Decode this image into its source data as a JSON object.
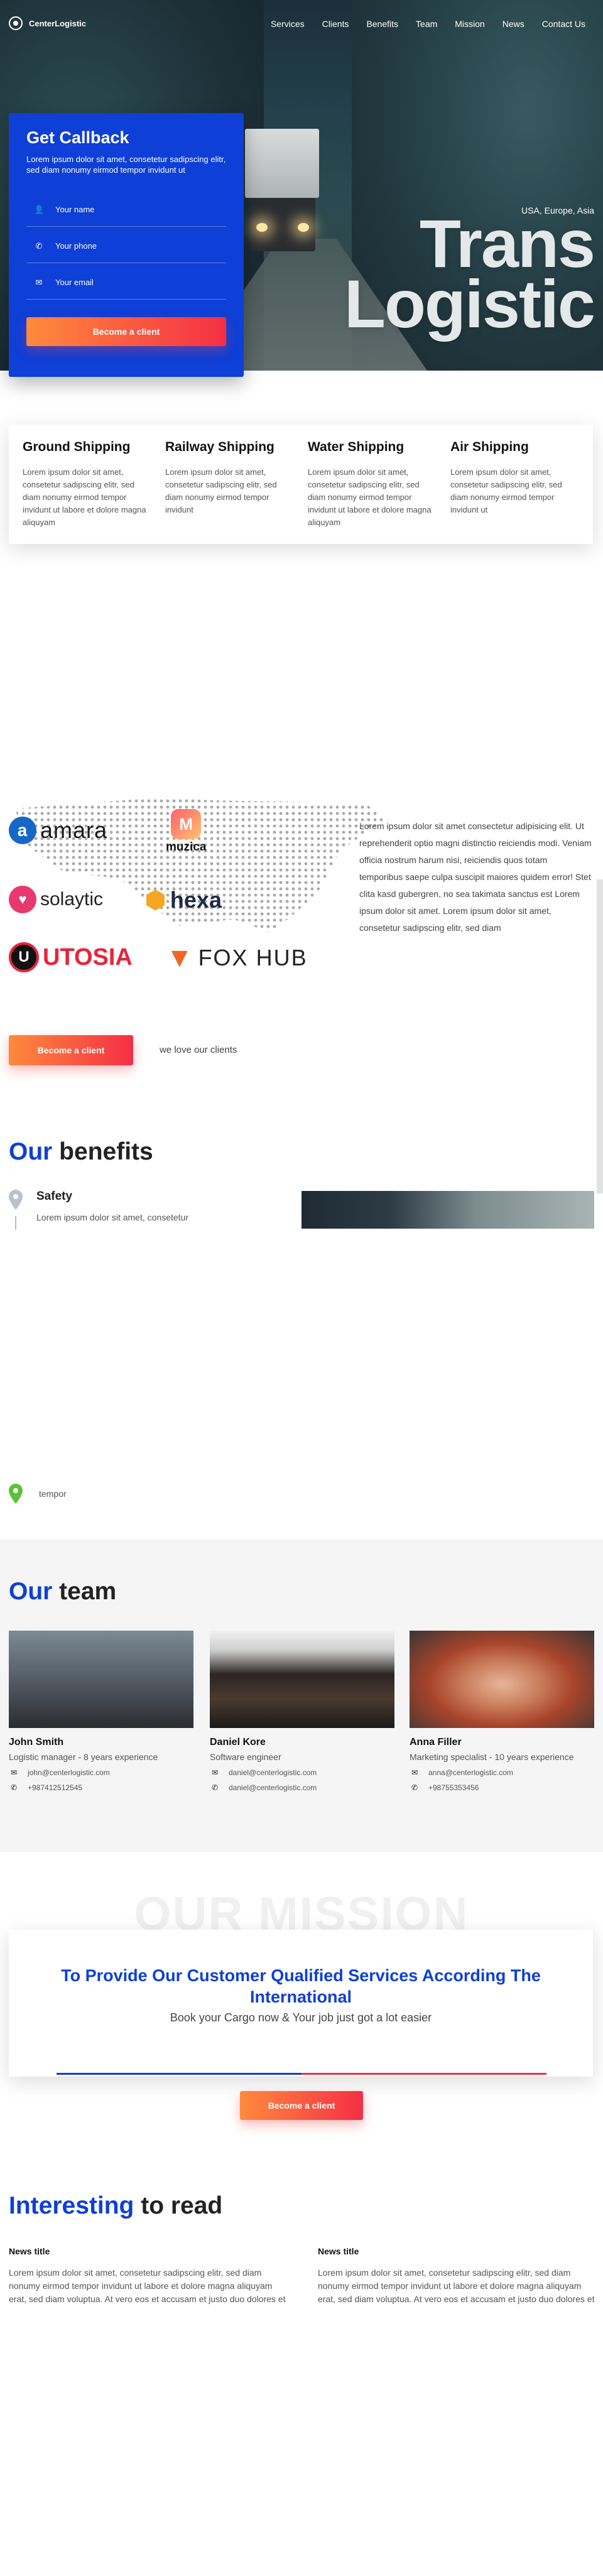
{
  "nav": {
    "logo_text": "CenterLogistic",
    "items": [
      "Services",
      "Clients",
      "Benefits",
      "Team",
      "Mission",
      "News",
      "Contact Us"
    ]
  },
  "callback": {
    "title": "Get Callback",
    "text": "Lorem ipsum dolor sit amet, consetetur sadipscing elitr, sed diam nonumy eirmod tempor invidunt ut",
    "fields": [
      {
        "icon": "user-icon",
        "placeholder": "Your name"
      },
      {
        "icon": "phone-icon",
        "placeholder": "Your phone"
      },
      {
        "icon": "mail-icon",
        "placeholder": "Your email"
      }
    ],
    "button": "Become a client"
  },
  "hero": {
    "subtitle": "USA, Europe, Asia",
    "title_line1": "Trans",
    "title_line2": "Logistic"
  },
  "services": [
    {
      "title": "Ground Shipping",
      "text": "Lorem ipsum dolor sit amet, consetetur sadipscing elitr, sed diam nonumy eirmod tempor invidunt ut labore et dolore magna aliquyam"
    },
    {
      "title": "Railway Shipping",
      "text": "Lorem ipsum dolor sit amet, consetetur sadipscing elitr, sed diam nonumy eirmod tempor invidunt"
    },
    {
      "title": "Water Shipping",
      "text": "Lorem ipsum dolor sit amet, consetetur sadipscing elitr, sed diam nonumy eirmod tempor invidunt ut labore et dolore magna aliquyam"
    },
    {
      "title": "Air Shipping",
      "text": "Lorem ipsum dolor sit amet, consetetur sadipscing elitr, sed diam nonumy eirmod tempor invidunt ut"
    }
  ],
  "clients": {
    "logos": [
      "amara",
      "muzica",
      "solaytic",
      "hexa",
      "UTOSIA",
      "FOX HUB"
    ],
    "text": "Lorem ipsum dolor sit amet consectetur adipisicing elit. Ut reprehenderit optio magni distinctio reiciendis modi. Veniam officia nostrum harum nisi, reiciendis quos totam temporibus saepe culpa suscipit maiores quidem error! Stet clita kasd gubergren, no sea takimata sanctus est Lorem ipsum dolor sit amet. Lorem ipsum dolor sit amet, consetetur sadipscing elitr, sed diam",
    "button": "Become a client",
    "love": "we love our clients"
  },
  "benefits": {
    "title_blue": "Our",
    "title_rest": " benefits",
    "items": [
      {
        "title": "Safety",
        "text": "Lorem ipsum dolor sit amet, consetetur"
      }
    ],
    "bottom_text": "tempor"
  },
  "team": {
    "title_blue": "Our",
    "title_rest": " team",
    "members": [
      {
        "name": "John Smith",
        "role": "Logistic manager - 8 years experience",
        "email": "john@centerlogistic.com",
        "phone": "+987412512545"
      },
      {
        "name": "Daniel Kore",
        "role": "Software engineer",
        "email": "daniel@centerlogistic.com",
        "phone": "daniel@centerlogistic.com"
      },
      {
        "name": "Anna Filler",
        "role": "Marketing specialist - 10 years experience",
        "email": "anna@centerlogistic.com",
        "phone": "+98755353456"
      }
    ]
  },
  "mission": {
    "ghost": "OUR MISSION",
    "title": "To Provide Our Customer Qualified Services According The International",
    "subtitle": "Book your Cargo now & Your job just got a lot easier",
    "button": "Become a client"
  },
  "news": {
    "title_blue": "Interesting",
    "title_rest": " to read",
    "items": [
      {
        "title": "News title",
        "text": "Lorem ipsum dolor sit amet, consetetur sadipscing elitr, sed diam nonumy eirmod tempor invidunt ut labore et dolore magna aliquyam erat, sed diam voluptua. At vero eos et accusam et justo duo dolores et ea rebum. Stet clita kasd gubergren, no sea takimata"
      },
      {
        "title": "News title",
        "text": "Lorem ipsum dolor sit amet, consetetur sadipscing elitr, sed diam nonumy eirmod tempor invidunt ut labore et dolore magna aliquyam erat, sed diam voluptua. At vero eos et accusam et justo duo dolores et ea rebum. Stet clita kasd gubergren, no sea takimata"
      }
    ]
  },
  "colors": {
    "brand_blue": "#0e3fd6",
    "accent_orange": "#ff8a3d",
    "accent_red": "#f42f45"
  }
}
